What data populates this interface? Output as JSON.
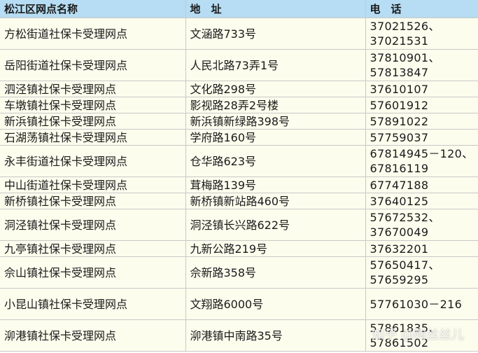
{
  "header": {
    "name": "松江区网点名称",
    "address": "地　址",
    "phone": "电　话"
  },
  "rows": [
    {
      "name": "方松街道社保卡受理网点",
      "address": "文涵路733号",
      "phone": "37021526、37021531",
      "lines": 2
    },
    {
      "name": "岳阳街道社保卡受理网点",
      "address": "人民北路73弄1号",
      "phone": "37810901、57813847",
      "lines": 2
    },
    {
      "name": "泗泾镇社保卡受理网点",
      "address": "文化路298号",
      "phone": "37610107",
      "lines": 1
    },
    {
      "name": "车墩镇社保卡受理网点",
      "address": "影视路28弄2号楼",
      "phone": "57601912",
      "lines": 1
    },
    {
      "name": "新浜镇社保卡受理网点",
      "address": "新浜镇新绿路398号",
      "phone": "57891022",
      "lines": 1
    },
    {
      "name": "石湖荡镇社保卡受理网点",
      "address": "学府路160号",
      "phone": "57759037",
      "lines": 1
    },
    {
      "name": "永丰街道社保卡受理网点",
      "address": "仓华路623号",
      "phone": "67814945－120、67816119",
      "lines": 2
    },
    {
      "name": "中山街道社保卡受理网点",
      "address": "茸梅路139号",
      "phone": "67747188",
      "lines": 1
    },
    {
      "name": "新桥镇社保卡受理网点",
      "address": "新桥镇新站路460号",
      "phone": "37640125",
      "lines": 1
    },
    {
      "name": "洞泾镇社保卡受理网点",
      "address": "洞泾镇长兴路622号",
      "phone": "57672532、37670049",
      "lines": 2
    },
    {
      "name": "九亭镇社保卡受理网点",
      "address": "九新公路219号",
      "phone": "37632201",
      "lines": 1
    },
    {
      "name": "佘山镇社保卡受理网点",
      "address": "佘新路358号",
      "phone": "57650417、57659295",
      "lines": 2
    },
    {
      "name": "小昆山镇社保卡受理网点",
      "address": "文翔路6000号",
      "phone": "57761030－216",
      "lines": 2
    },
    {
      "name": "泖港镇社保卡受理网点",
      "address": "泖港镇中南路35号",
      "phone": "57861835、57861502",
      "lines": 2
    }
  ],
  "watermark": "知乎 @陶丝丝儿"
}
